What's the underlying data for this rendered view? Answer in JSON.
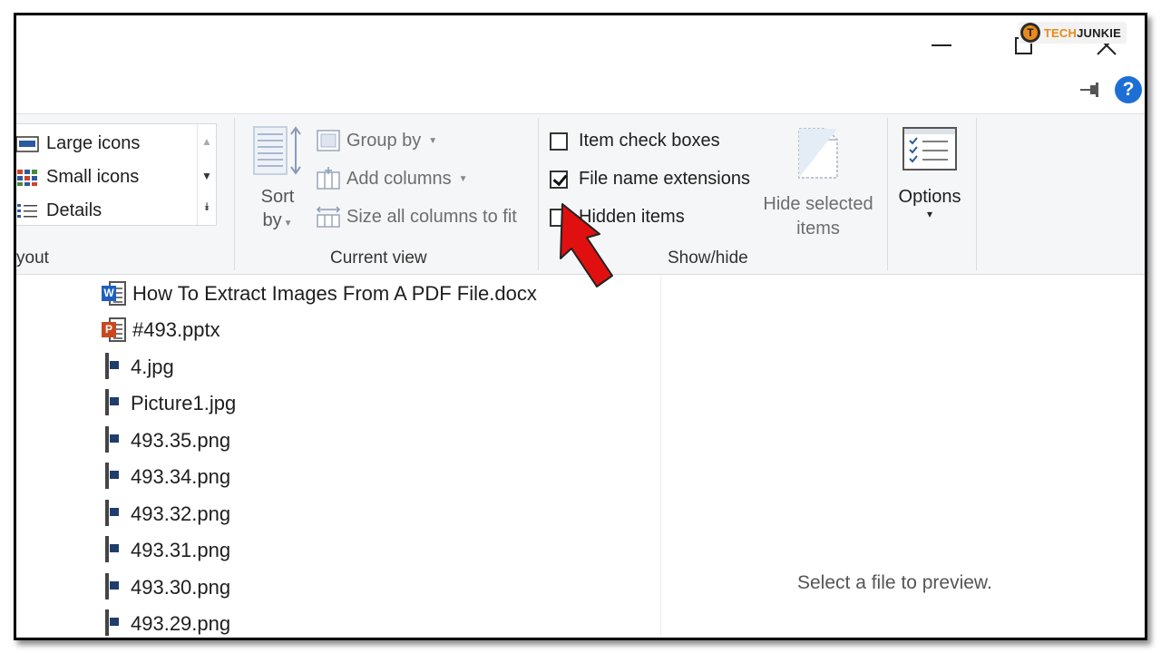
{
  "watermark": {
    "part1": "TECH",
    "part2": "JUNKIE"
  },
  "ribbon": {
    "layout": {
      "items": [
        "Large icons",
        "Small icons",
        "Details"
      ],
      "label": "yout"
    },
    "current_view": {
      "sort_line1": "Sort",
      "sort_line2": "by",
      "group_by": "Group by",
      "add_columns": "Add columns",
      "size_columns": "Size all columns to fit",
      "label": "Current view"
    },
    "show_hide": {
      "item_check_boxes": {
        "label": "Item check boxes",
        "checked": false
      },
      "file_name_extensions": {
        "label": "File name extensions",
        "checked": true
      },
      "hidden_items": {
        "label": "Hidden items",
        "checked": false
      },
      "hide_selected_line1": "Hide selected",
      "hide_selected_line2": "items",
      "label": "Show/hide"
    },
    "options": {
      "label": "Options",
      "caret": "▾"
    }
  },
  "files": [
    {
      "name": "How To Extract Images From A PDF File.docx",
      "icon": "word-doc-icon"
    },
    {
      "name": "#493.pptx",
      "icon": "powerpoint-icon"
    },
    {
      "name": "4.jpg",
      "icon": "image-file-icon"
    },
    {
      "name": "Picture1.jpg",
      "icon": "image-file-icon"
    },
    {
      "name": "493.35.png",
      "icon": "image-file-icon"
    },
    {
      "name": "493.34.png",
      "icon": "image-file-icon"
    },
    {
      "name": "493.32.png",
      "icon": "image-file-icon"
    },
    {
      "name": "493.31.png",
      "icon": "image-file-icon"
    },
    {
      "name": "493.30.png",
      "icon": "image-file-icon"
    },
    {
      "name": "493.29.png",
      "icon": "image-file-icon"
    }
  ],
  "preview": {
    "message": "Select a file to preview."
  },
  "colors": {
    "help": "#1d6fd6",
    "arrow": "#e01010",
    "accent_orange": "#e88b1a"
  }
}
